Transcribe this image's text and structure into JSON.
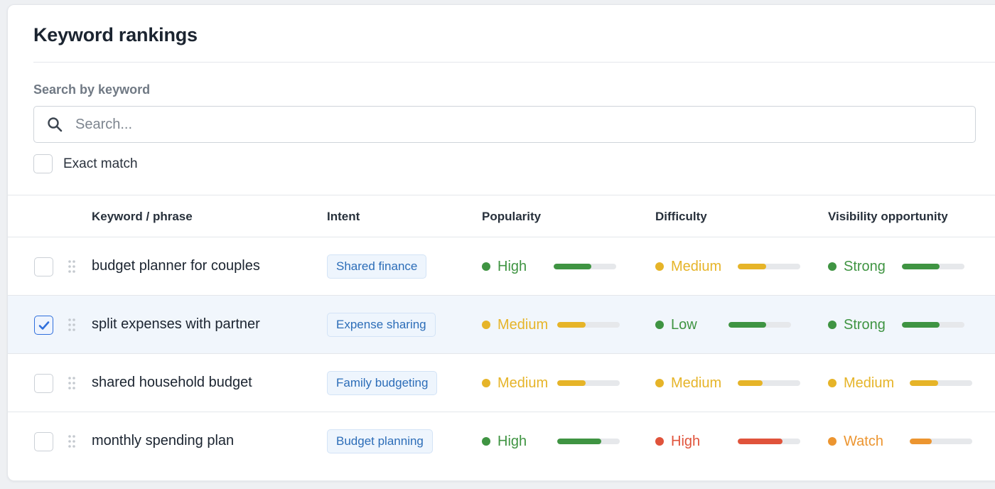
{
  "page": {
    "title": "Keyword rankings",
    "search_label": "Search by keyword",
    "search_placeholder": "Search...",
    "search_value": "",
    "exact_match_label": "Exact match",
    "exact_match_checked": false
  },
  "table": {
    "columns": {
      "keyword": "Keyword / phrase",
      "intent": "Intent",
      "popularity": "Popularity",
      "difficulty": "Difficulty",
      "visibility": "Visibility opportunity"
    },
    "rows": [
      {
        "keyword": "budget planner for couples",
        "intent": "Shared finance",
        "selected": false,
        "popularity": {
          "label": "High",
          "color": "#3f9442",
          "level": 0.6
        },
        "difficulty": {
          "label": "Medium",
          "color": "#e6b428",
          "level": 0.45
        },
        "visibility": {
          "label": "Strong",
          "color": "#3f9442",
          "level": 0.6
        }
      },
      {
        "keyword": "split expenses with partner",
        "intent": "Expense sharing",
        "selected": true,
        "popularity": {
          "label": "Medium",
          "color": "#e6b428",
          "level": 0.45
        },
        "difficulty": {
          "label": "Low",
          "color": "#3f9442",
          "level": 0.6
        },
        "visibility": {
          "label": "Strong",
          "color": "#3f9442",
          "level": 0.6
        }
      },
      {
        "keyword": "shared household budget",
        "intent": "Family budgeting",
        "selected": false,
        "popularity": {
          "label": "Medium",
          "color": "#e6b428",
          "level": 0.45
        },
        "difficulty": {
          "label": "Medium",
          "color": "#e6b428",
          "level": 0.4
        },
        "visibility": {
          "label": "Medium",
          "color": "#e6b428",
          "level": 0.45
        }
      },
      {
        "keyword": "monthly spending plan",
        "intent": "Budget planning",
        "selected": false,
        "popularity": {
          "label": "High",
          "color": "#3f9442",
          "level": 0.7
        },
        "difficulty": {
          "label": "High",
          "color": "#e0533b",
          "level": 0.72
        },
        "visibility": {
          "label": "Watch",
          "color": "#ec9530",
          "level": 0.35
        }
      }
    ]
  },
  "colors": {
    "checkbox_checked": "#2f6fdc",
    "pill_text": "#2c6db8"
  }
}
